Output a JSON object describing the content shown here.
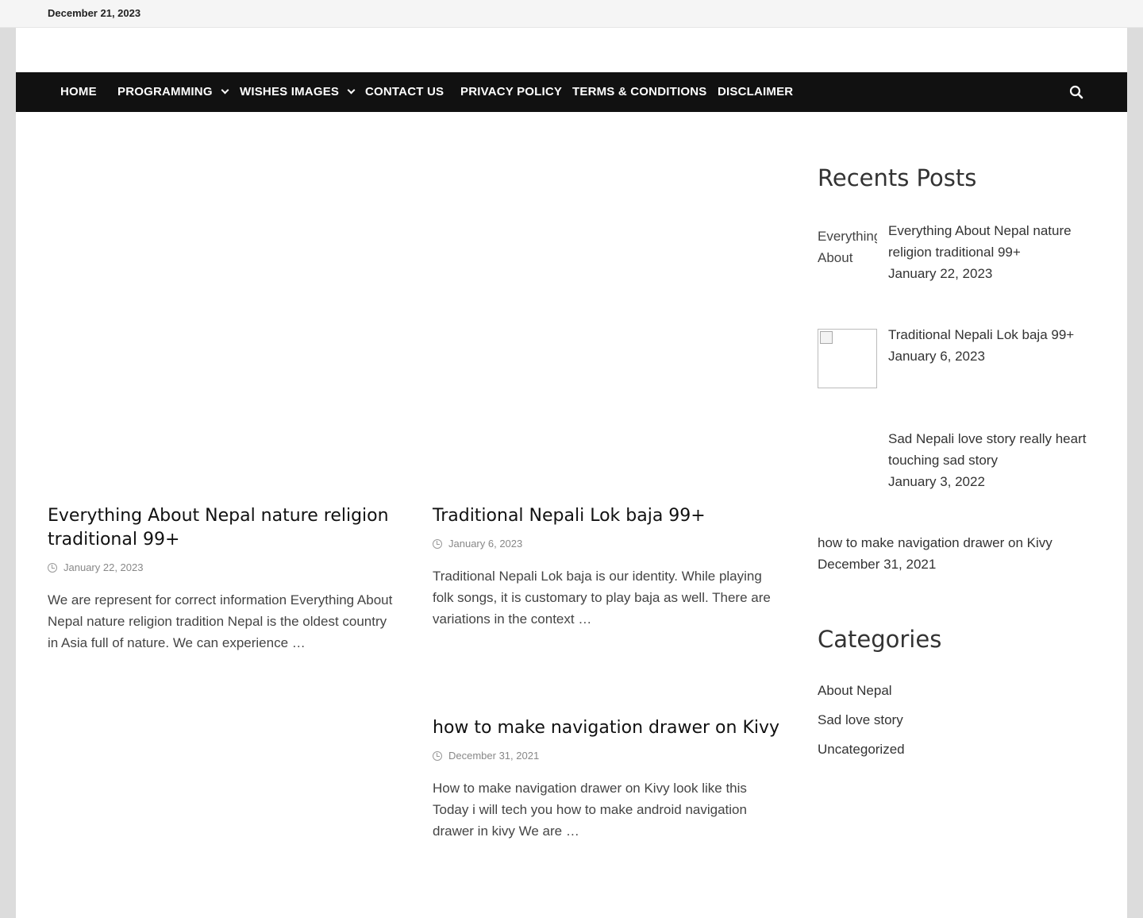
{
  "topbar": {
    "date": "December 21, 2023"
  },
  "nav": {
    "items": [
      {
        "label": "HOME",
        "dropdown": false
      },
      {
        "label": "PROGRAMMING",
        "dropdown": true
      },
      {
        "label": "WISHES IMAGES",
        "dropdown": true
      },
      {
        "label": "CONTACT US",
        "dropdown": false
      },
      {
        "label": "PRIVACY POLICY",
        "dropdown": false
      },
      {
        "label": "TERMS & CONDITIONS",
        "dropdown": false
      },
      {
        "label": "DISCLAIMER",
        "dropdown": false
      }
    ],
    "search_icon": "search-icon"
  },
  "posts": [
    {
      "title": "Everything About Nepal nature religion traditional 99+",
      "date": "January 22, 2023",
      "excerpt": "We are represent for correct information Everything About Nepal nature religion tradition Nepal is the oldest country in Asia full of nature. We can experience …"
    },
    {
      "title": "Traditional Nepali Lok baja 99+",
      "date": "January 6, 2023",
      "excerpt": "Traditional Nepali Lok baja  is our identity.  While playing folk songs, it is customary to play baja as well.  There are variations in the  context …"
    },
    {
      "title": "how to make navigation drawer on Kivy",
      "date": "December 31, 2021",
      "excerpt": "How to make navigation drawer on Kivy look like this Today i will tech you how to  make android navigation drawer in kivy We are …"
    }
  ],
  "sidebar": {
    "recent_title": "Recents Posts",
    "recent": [
      {
        "thumb_alt": "Everything About",
        "title": "Everything About Nepal nature religion traditional 99+",
        "date": "January 22, 2023"
      },
      {
        "thumb_alt": "",
        "title": "Traditional Nepali Lok baja 99+",
        "date": "January 6, 2023"
      },
      {
        "thumb_alt": "",
        "title": "Sad Nepali love story really heart touching sad story",
        "date": "January 3, 2022"
      },
      {
        "thumb_alt": "",
        "title": "how to make navigation drawer on Kivy",
        "date": "December 31, 2021"
      }
    ],
    "categories_title": "Categories",
    "categories": [
      "About Nepal",
      "Sad love story",
      "Uncategorized"
    ]
  }
}
